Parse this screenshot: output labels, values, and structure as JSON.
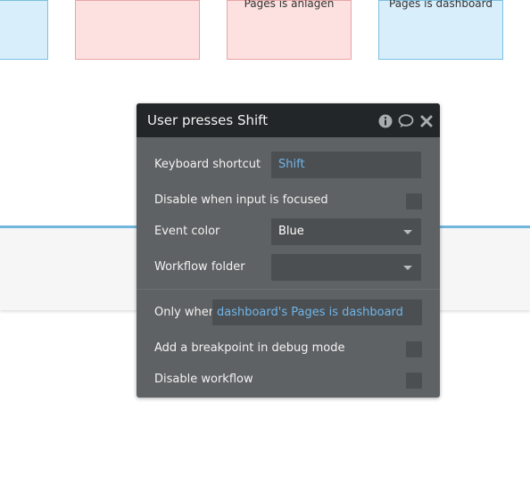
{
  "canvas": {
    "cards": [
      {
        "text": "",
        "color": "#d8eefb"
      },
      {
        "text": "",
        "color": "#fde0e0"
      },
      {
        "text": "Pages is anlagen",
        "color": "#fde0e0"
      },
      {
        "text": "Pages is dashboard",
        "color": "#d8eefb"
      }
    ]
  },
  "panel": {
    "title": "User presses Shift",
    "header_icons": [
      "info-icon",
      "comment-icon",
      "close-icon"
    ],
    "keyboard_shortcut": {
      "label": "Keyboard shortcut",
      "value": "Shift"
    },
    "disable_when_focused": {
      "label": "Disable when input is focused",
      "checked": false
    },
    "event_color": {
      "label": "Event color",
      "value": "Blue"
    },
    "workflow_folder": {
      "label": "Workflow folder",
      "value": ""
    },
    "only_when": {
      "label": "Only when",
      "value": "dashboard's Pages is dashboard"
    },
    "breakpoint": {
      "label": "Add a breakpoint in debug mode",
      "checked": false
    },
    "disable_workflow": {
      "label": "Disable workflow",
      "checked": false
    }
  },
  "colors": {
    "accent_text": "#6fb5ea",
    "panel_bg": "#5f6264",
    "header_bg": "#222628"
  }
}
